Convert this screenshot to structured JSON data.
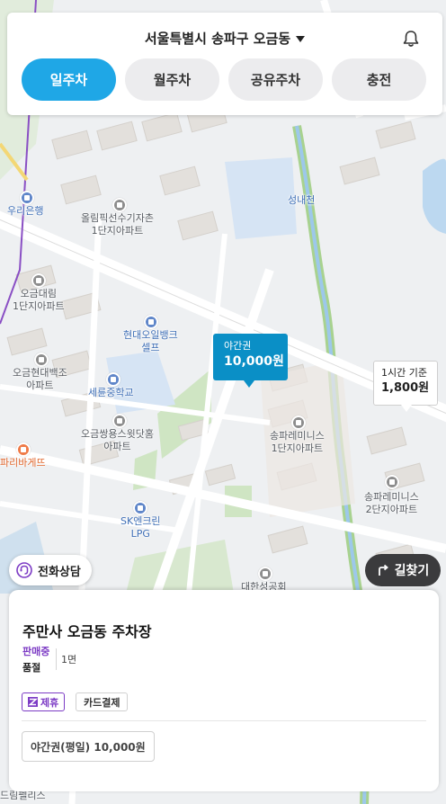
{
  "header": {
    "location": "서울특별시 송파구 오금동",
    "tabs": [
      {
        "label": "일주차",
        "active": true
      },
      {
        "label": "월주차",
        "active": false
      },
      {
        "label": "공유주차",
        "active": false
      },
      {
        "label": "충전",
        "active": false
      }
    ]
  },
  "map": {
    "labels": {
      "bank": "우리은행",
      "olympic_village": "올림픽선수기자촌\n1단지아파트",
      "seongnaecheon": "성내천",
      "ogeum_daelim": "오금대림\n1단지아파트",
      "hyundai_oil": "현대오일뱅크\n셀프",
      "ogeum_hyundai": "오금현대백조\n아파트",
      "seryun_school": "세륜중학교",
      "ssangyong": "오금쌍용스윗닷홈\n아파트",
      "songpa_remimis1": "송파레미니스\n1단지아파트",
      "paris": "파리바게뜨",
      "sk_lpg": "SK엔크린\nLPG",
      "songpa_remimis2": "송파레미니스\n2단지아파트",
      "church": "대한성공회",
      "bottom_left": "드림펠리스"
    }
  },
  "markers": {
    "main": {
      "line1": "야간권",
      "line2": "10,000원"
    },
    "side": {
      "line1": "1시간 기준",
      "line2": "1,800원"
    }
  },
  "buttons": {
    "phone": "전화상담",
    "route": "길찾기"
  },
  "sheet": {
    "name": "주만사 오금동 주차장",
    "status_sale": "판매중",
    "status_sold": "품절",
    "slots": "1면",
    "tag_partner": "제휴",
    "tag_card": "카드결제",
    "price": "야간권(평일) 10,000원"
  },
  "colors": {
    "accent": "#1fa7e6",
    "marker": "#0a8fc6",
    "partner": "#7d3cc5",
    "route_button": "#3b3b3d"
  }
}
